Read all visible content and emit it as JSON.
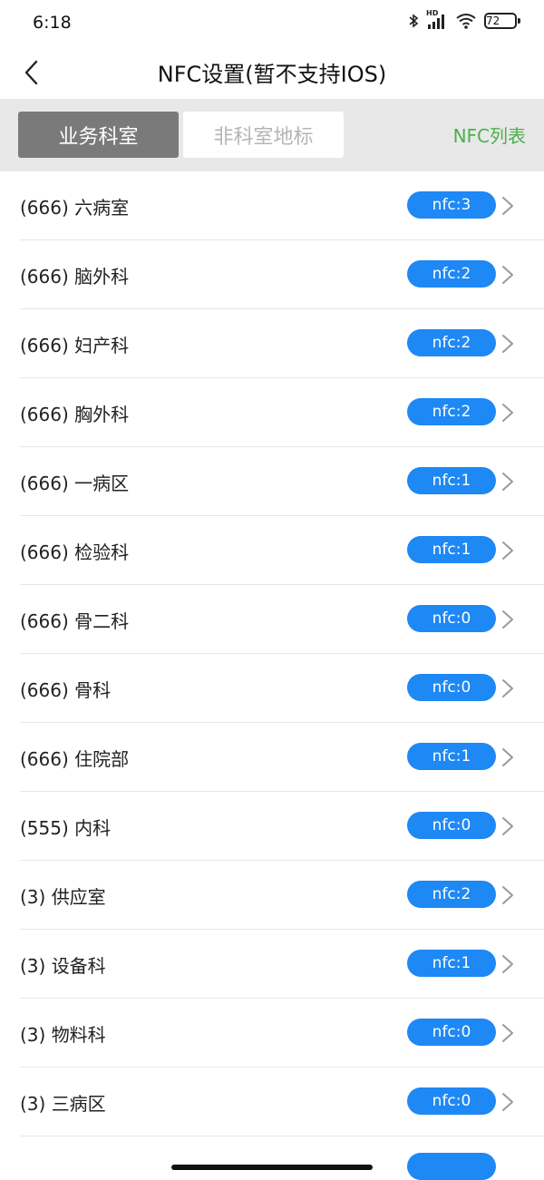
{
  "status_bar": {
    "time": "6:18",
    "hd_label": "HD",
    "battery": "72"
  },
  "nav": {
    "title": "NFC设置(暂不支持IOS)"
  },
  "tabs": [
    {
      "label": "业务科室",
      "active": true
    },
    {
      "label": "非科室地标",
      "active": false
    }
  ],
  "nfc_list_link": "NFC列表",
  "colors": {
    "badge": "#1e88f5",
    "link": "#4caf50",
    "active_tab": "#7a7a7a"
  },
  "items": [
    {
      "label": "(666) 六病室",
      "badge": "nfc:3"
    },
    {
      "label": "(666) 脑外科",
      "badge": "nfc:2"
    },
    {
      "label": "(666) 妇产科",
      "badge": "nfc:2"
    },
    {
      "label": "(666) 胸外科",
      "badge": "nfc:2"
    },
    {
      "label": "(666) 一病区",
      "badge": "nfc:1"
    },
    {
      "label": "(666) 检验科",
      "badge": "nfc:1"
    },
    {
      "label": "(666) 骨二科",
      "badge": "nfc:0"
    },
    {
      "label": "(666) 骨科",
      "badge": "nfc:0"
    },
    {
      "label": "(666) 住院部",
      "badge": "nfc:1"
    },
    {
      "label": "(555) 内科",
      "badge": "nfc:0"
    },
    {
      "label": "(3) 供应室",
      "badge": "nfc:2"
    },
    {
      "label": "(3) 设备科",
      "badge": "nfc:1"
    },
    {
      "label": "(3) 物料科",
      "badge": "nfc:0"
    },
    {
      "label": "(3) 三病区",
      "badge": "nfc:0"
    }
  ]
}
